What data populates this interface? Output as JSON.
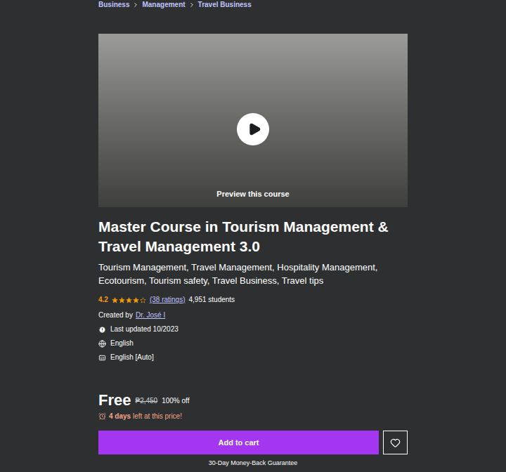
{
  "breadcrumb": [
    {
      "label": "Business"
    },
    {
      "label": "Management"
    },
    {
      "label": "Travel Business"
    }
  ],
  "preview": {
    "label": "Preview this course"
  },
  "course": {
    "title": "Master Course in Tourism Management & Travel Management 3.0",
    "subtitle": "Tourism Management, Travel Management, Hospitality Management, Ecotourism, Tourism safety, Travel Business, Travel tips",
    "rating": "4.2",
    "stars": 4.2,
    "ratings_count": "(38 ratings)",
    "students": "4,951 students",
    "created_by_label": "Created by",
    "author": "Dr. José I",
    "last_updated": "Last updated 10/2023",
    "language": "English",
    "captions": "English [Auto]"
  },
  "pricing": {
    "price": "Free",
    "original_price": "₱2,450",
    "discount": "100% off",
    "deadline_bold": "4 days",
    "deadline_text": "left at this price!"
  },
  "buttons": {
    "add_to_cart": "Add to cart",
    "wishlist_selected": false
  },
  "guarantee": "30-Day Money-Back Guarantee"
}
